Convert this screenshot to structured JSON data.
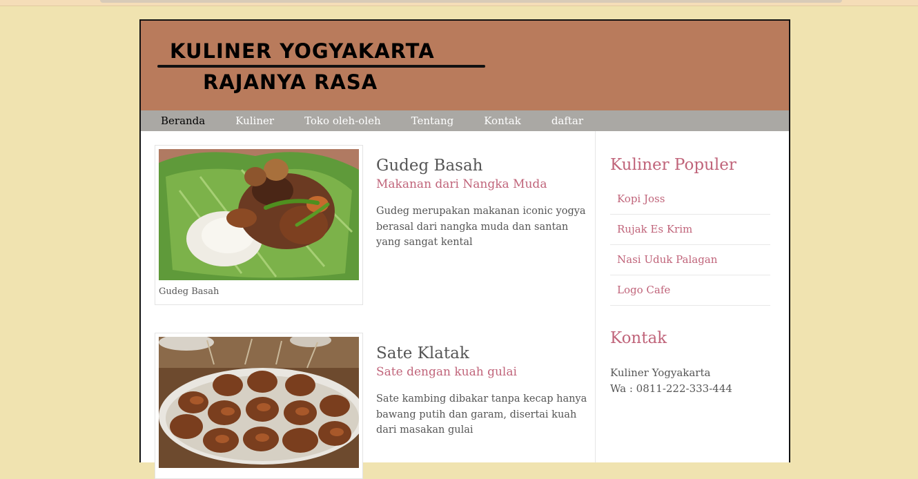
{
  "header": {
    "title_line1": "KULINER YOGYAKARTA",
    "title_line2": "RAJANYA RASA"
  },
  "nav": {
    "items": [
      "Beranda",
      "Kuliner",
      "Toko oleh-oleh",
      "Tentang",
      "Kontak",
      "daftar"
    ]
  },
  "articles": [
    {
      "caption": "Gudeg Basah",
      "title": "Gudeg Basah",
      "subtitle": "Makanan dari Nangka Muda",
      "text": "Gudeg merupakan makanan iconic yogya berasal dari nangka muda dan santan yang sangat kental"
    },
    {
      "title": "Sate Klatak",
      "subtitle": "Sate dengan kuah gulai",
      "text": "Sate kambing dibakar tanpa kecap hanya bawang putih dan garam, disertai kuah dari masakan gulai"
    }
  ],
  "sidebar": {
    "popular_heading": "Kuliner Populer",
    "popular_items": [
      "Kopi Joss",
      "Rujak Es Krim",
      "Nasi Uduk Palagan",
      "Logo Cafe"
    ],
    "contact_heading": "Kontak",
    "contact_name": "Kuliner Yogyakarta",
    "contact_phone": "Wa : 0811-222-333-444"
  },
  "colors": {
    "page_background": "#f0e3b0",
    "header_background": "#b97b5c",
    "nav_background": "#aaa8a4",
    "accent": "#c0647a",
    "body_text": "#555555"
  }
}
